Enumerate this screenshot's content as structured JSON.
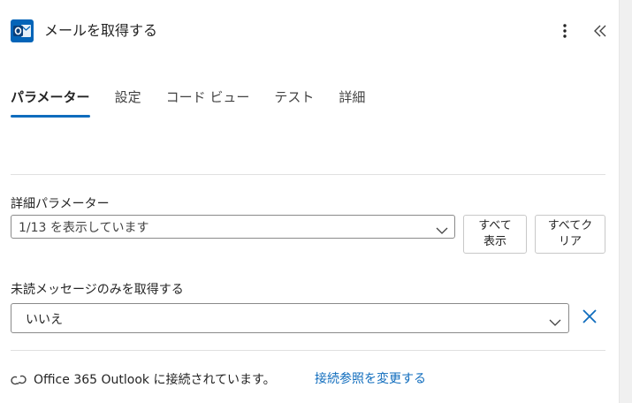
{
  "header": {
    "title": "メールを取得する",
    "app_icon": "outlook-icon",
    "more_icon": "more-vertical-icon",
    "collapse_icon": "double-chevron-left-icon"
  },
  "tabs": [
    {
      "label": "パラメーター",
      "active": true
    },
    {
      "label": "設定",
      "active": false
    },
    {
      "label": "コード ビュー",
      "active": false
    },
    {
      "label": "テスト",
      "active": false
    },
    {
      "label": "詳細",
      "active": false
    }
  ],
  "advanced": {
    "label": "詳細パラメーター",
    "dropdown_value": "1/13 を表示しています",
    "show_all_line1": "すべて",
    "show_all_line2": "表示",
    "clear_all_line1": "すべてク",
    "clear_all_line2": "リア"
  },
  "unread_only": {
    "label": "未読メッセージのみを取得する",
    "value": "いいえ"
  },
  "connection": {
    "text": "Office 365 Outlook に接続されています。",
    "change_link": "接続参照を変更する"
  },
  "colors": {
    "accent": "#0f6cbd",
    "outlook_blue": "#0364b8"
  }
}
